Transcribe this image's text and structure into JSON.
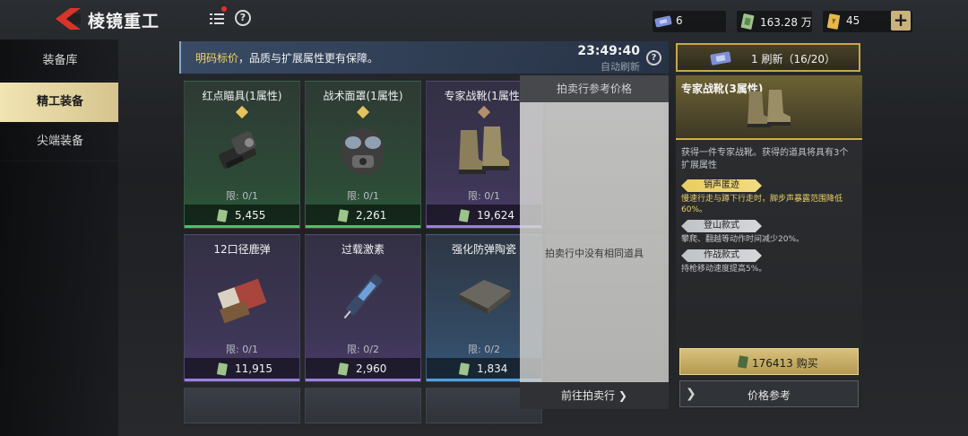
{
  "header": {
    "title": "棱镜重工",
    "back_icon": "back-arrow-icon",
    "menu_icon": "list-menu-icon",
    "help_icon": "help-icon",
    "help_glyph": "?"
  },
  "currencies": [
    {
      "icon": "ticket-icon",
      "value": "6"
    },
    {
      "icon": "cash-icon",
      "value": "163.28 万"
    },
    {
      "icon": "voucher-icon",
      "value": "45"
    }
  ],
  "plus_label": "+",
  "sidebar": {
    "items": [
      {
        "label": "装备库",
        "active": false
      },
      {
        "label": "精工装备",
        "active": true
      },
      {
        "label": "尖端装备",
        "active": false
      }
    ]
  },
  "notice": {
    "highlight": "明码标价",
    "text": "，品质与扩展属性更有保障。",
    "timer": "23:49:40",
    "timer_sub": "自动刷新",
    "help_glyph": "?"
  },
  "refresh": {
    "label": "1 刷新（16/20）"
  },
  "items": [
    {
      "name": "红点瞄具(1属性)",
      "limit": "限: 0/1",
      "price": "5,455",
      "rarity": "green",
      "diamond": "gold"
    },
    {
      "name": "战术面罩(1属性)",
      "limit": "限: 0/1",
      "price": "2,261",
      "rarity": "green",
      "diamond": "gold"
    },
    {
      "name": "专家战靴(1属性)",
      "limit": "限: 0/1",
      "price": "19,624",
      "rarity": "purple",
      "diamond": "bronze"
    },
    {
      "name": "12口径鹿弹",
      "limit": "限: 0/1",
      "price": "11,915",
      "rarity": "purple",
      "diamond": ""
    },
    {
      "name": "过载激素",
      "limit": "限: 0/2",
      "price": "2,960",
      "rarity": "purple",
      "diamond": ""
    },
    {
      "name": "强化防弹陶瓷",
      "limit": "限: 0/2",
      "price": "1,834",
      "rarity": "blue",
      "diamond": ""
    }
  ],
  "auction": {
    "header": "拍卖行参考价格",
    "empty_message": "拍卖行中没有相同道具",
    "link": "前往拍卖行"
  },
  "detail": {
    "title": "专家战靴(3属性)",
    "description": "获得一件专家战靴。获得的道具将具有3个扩展属性",
    "attributes": [
      {
        "name": "销声匿迹",
        "desc": "慢速行走与蹲下行走时，脚步声暴露范围降低60%。",
        "tier": "gold"
      },
      {
        "name": "登山款式",
        "desc": "攀爬、翻越等动作时间减少20%。",
        "tier": "silver"
      },
      {
        "name": "作战款式",
        "desc": "持枪移动速度提高5%。",
        "tier": "silver"
      }
    ],
    "buy_label": "176413 购买",
    "ref_label": "价格参考",
    "ref_arrow": "❯"
  },
  "colors": {
    "accent_gold": "#cfae4c",
    "active_tab": "#f0e4b4",
    "rarity_green": "#4fbf6a",
    "rarity_purple": "#9b7fe0",
    "rarity_blue": "#4f9fe0",
    "back_red": "#d8342c"
  }
}
